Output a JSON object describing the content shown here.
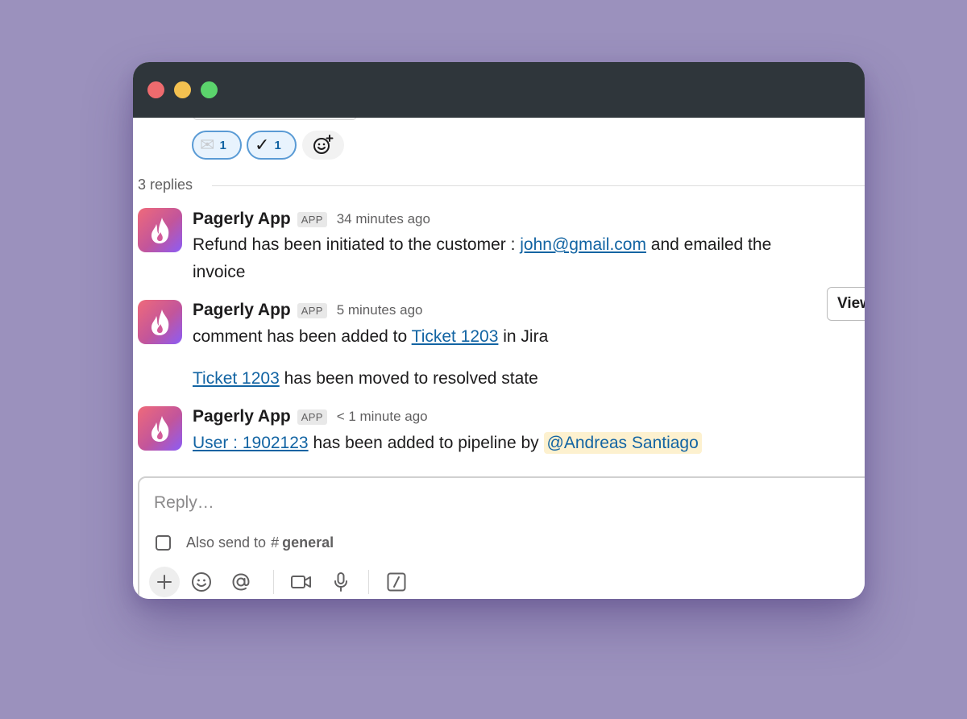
{
  "reactions": [
    {
      "icon": "envelope-icon",
      "emoji": "✉",
      "count": "1"
    },
    {
      "icon": "checkmark-icon",
      "emoji": "✓",
      "count": "1"
    }
  ],
  "thread": {
    "replies_label": "3 replies"
  },
  "messages": [
    {
      "sender": "Pagerly App",
      "badge": "APP",
      "time": "34 minutes ago",
      "text_1": "Refund has been initiated to the customer : ",
      "email": "john@gmail.com",
      "text_2": " and emailed the invoice",
      "button": "View"
    },
    {
      "sender": "Pagerly App",
      "badge": "APP",
      "time": "5 minutes ago",
      "line1_prefix": "comment has been added to ",
      "line1_link": "Ticket 1203",
      "line1_suffix": " in Jira",
      "line2_link": "Ticket 1203",
      "line2_suffix": " has been moved to resolved state"
    },
    {
      "sender": "Pagerly App",
      "badge": "APP",
      "time": "< 1 minute ago",
      "user_link": "User : 1902123",
      "text": " has been added to pipeline by ",
      "mention": "@Andreas Santiago"
    }
  ],
  "composer": {
    "placeholder": "Reply…",
    "also_send_label": "Also send to",
    "hash": "#",
    "channel": "general",
    "tools": [
      "plus-icon",
      "emoji-icon",
      "mention-icon",
      "video-icon",
      "microphone-icon",
      "slash-command-icon"
    ]
  },
  "colors": {
    "background": "#9b91bd",
    "titlebar": "#2f363b",
    "link": "#1264a3",
    "mention_bg": "#fdf1cf",
    "reaction_border": "#5a9bd5"
  }
}
